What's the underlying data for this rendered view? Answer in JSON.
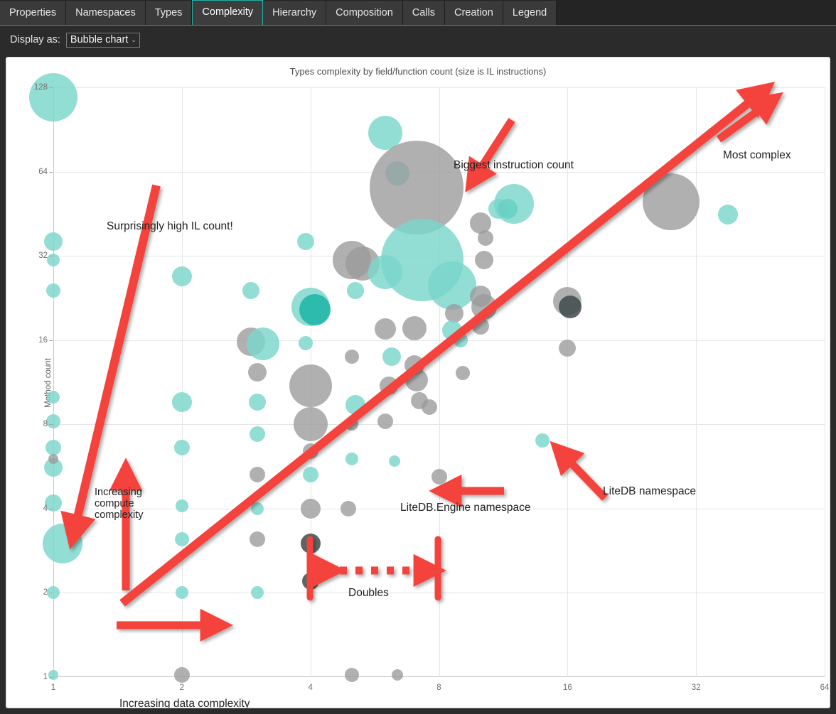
{
  "window": {
    "tabs": [
      {
        "label": "Properties",
        "active": false
      },
      {
        "label": "Namespaces",
        "active": false
      },
      {
        "label": "Types",
        "active": false
      },
      {
        "label": "Complexity",
        "active": true
      },
      {
        "label": "Hierarchy",
        "active": false
      },
      {
        "label": "Composition",
        "active": false
      },
      {
        "label": "Calls",
        "active": false
      },
      {
        "label": "Creation",
        "active": false
      },
      {
        "label": "Legend",
        "active": false
      }
    ]
  },
  "toolbar": {
    "display_as_label": "Display as:",
    "display_as_value": "Bubble chart",
    "chevron": "⌄"
  },
  "colors": {
    "teal": "#7ad6cb",
    "grey": "#9a9a9a",
    "annotation_red": "#f4433c",
    "accent": "#1fb3a5",
    "chrome": "#2b2b2b"
  },
  "chart_data": {
    "type": "scatter",
    "title": "Types complexity by field/function count (size is IL instructions)",
    "xlabel": "",
    "ylabel": "Method count",
    "xscale": "log2",
    "yscale": "log2",
    "xlim": [
      1,
      64
    ],
    "ylim": [
      1,
      128
    ],
    "xticks": [
      1,
      2,
      4,
      8,
      16,
      32,
      64
    ],
    "yticks": [
      1,
      2,
      4,
      8,
      16,
      32,
      64,
      128
    ],
    "grid": true,
    "legend": "none",
    "size_meaning": "IL instructions",
    "series": [
      {
        "name": "LiteDB namespace",
        "color": "#7ad6cb"
      },
      {
        "name": "LiteDB.Engine namespace",
        "color": "#9a9a9a"
      }
    ],
    "points": [
      {
        "x": 1.0,
        "y": 118,
        "r": 34,
        "c": "t"
      },
      {
        "x": 1.0,
        "y": 36,
        "r": 13,
        "c": "t"
      },
      {
        "x": 1.0,
        "y": 31,
        "r": 9,
        "c": "t"
      },
      {
        "x": 1.0,
        "y": 24,
        "r": 10,
        "c": "t"
      },
      {
        "x": 1.0,
        "y": 10,
        "r": 9,
        "c": "t"
      },
      {
        "x": 1.0,
        "y": 8.2,
        "r": 10,
        "c": "t"
      },
      {
        "x": 1.0,
        "y": 6.6,
        "r": 11,
        "c": "t"
      },
      {
        "x": 1.0,
        "y": 5.6,
        "r": 13,
        "c": "t"
      },
      {
        "x": 1.0,
        "y": 4.2,
        "r": 12,
        "c": "t"
      },
      {
        "x": 1.05,
        "y": 3.0,
        "r": 28,
        "c": "t"
      },
      {
        "x": 1.0,
        "y": 2.0,
        "r": 9,
        "c": "t"
      },
      {
        "x": 1.0,
        "y": 1.02,
        "r": 7,
        "c": "t"
      },
      {
        "x": 1.0,
        "y": 6.0,
        "r": 7,
        "c": "g"
      },
      {
        "x": 2.0,
        "y": 27,
        "r": 14,
        "c": "t"
      },
      {
        "x": 2.0,
        "y": 9.6,
        "r": 14,
        "c": "t"
      },
      {
        "x": 2.0,
        "y": 6.6,
        "r": 11,
        "c": "t"
      },
      {
        "x": 2.0,
        "y": 4.1,
        "r": 9,
        "c": "t"
      },
      {
        "x": 2.0,
        "y": 3.1,
        "r": 10,
        "c": "t"
      },
      {
        "x": 2.0,
        "y": 2.0,
        "r": 9,
        "c": "t"
      },
      {
        "x": 2.0,
        "y": 1.02,
        "r": 11,
        "c": "g"
      },
      {
        "x": 2.9,
        "y": 24,
        "r": 12,
        "c": "t"
      },
      {
        "x": 2.9,
        "y": 15.8,
        "r": 20,
        "c": "g"
      },
      {
        "x": 3.1,
        "y": 15.5,
        "r": 23,
        "c": "t"
      },
      {
        "x": 3.0,
        "y": 12.3,
        "r": 13,
        "c": "g"
      },
      {
        "x": 3.0,
        "y": 9.6,
        "r": 12,
        "c": "t"
      },
      {
        "x": 3.0,
        "y": 7.4,
        "r": 11,
        "c": "t"
      },
      {
        "x": 3.0,
        "y": 5.3,
        "r": 11,
        "c": "g"
      },
      {
        "x": 3.0,
        "y": 4.0,
        "r": 9,
        "c": "t"
      },
      {
        "x": 3.0,
        "y": 3.1,
        "r": 11,
        "c": "g"
      },
      {
        "x": 3.0,
        "y": 2.0,
        "r": 9,
        "c": "t"
      },
      {
        "x": 3.9,
        "y": 36,
        "r": 12,
        "c": "t"
      },
      {
        "x": 4.0,
        "y": 21,
        "r": 27,
        "c": "t"
      },
      {
        "x": 4.1,
        "y": 20.5,
        "r": 22,
        "c": "td"
      },
      {
        "x": 3.9,
        "y": 15.6,
        "r": 10,
        "c": "t"
      },
      {
        "x": 4.0,
        "y": 11,
        "r": 30,
        "c": "g"
      },
      {
        "x": 4.0,
        "y": 8.0,
        "r": 24,
        "c": "g"
      },
      {
        "x": 4.0,
        "y": 6.4,
        "r": 11,
        "c": "g"
      },
      {
        "x": 4.0,
        "y": 5.3,
        "r": 11,
        "c": "t"
      },
      {
        "x": 4.0,
        "y": 4.0,
        "r": 14,
        "c": "g"
      },
      {
        "x": 4.0,
        "y": 3.0,
        "r": 14,
        "c": "gd"
      },
      {
        "x": 4.0,
        "y": 2.2,
        "r": 12,
        "c": "gd"
      },
      {
        "x": 5.0,
        "y": 31,
        "r": 27,
        "c": "g"
      },
      {
        "x": 5.3,
        "y": 30,
        "r": 24,
        "c": "g"
      },
      {
        "x": 5.1,
        "y": 24,
        "r": 12,
        "c": "t"
      },
      {
        "x": 5.0,
        "y": 14,
        "r": 10,
        "c": "g"
      },
      {
        "x": 5.1,
        "y": 9.4,
        "r": 14,
        "c": "t"
      },
      {
        "x": 5.0,
        "y": 8.0,
        "r": 9,
        "c": "g"
      },
      {
        "x": 5.0,
        "y": 6.0,
        "r": 9,
        "c": "t"
      },
      {
        "x": 4.9,
        "y": 4.0,
        "r": 11,
        "c": "g"
      },
      {
        "x": 5.0,
        "y": 1.02,
        "r": 10,
        "c": "g"
      },
      {
        "x": 6.0,
        "y": 88,
        "r": 24,
        "c": "t"
      },
      {
        "x": 6.4,
        "y": 63,
        "r": 17,
        "c": "t"
      },
      {
        "x": 6.0,
        "y": 28,
        "r": 24,
        "c": "t"
      },
      {
        "x": 6.0,
        "y": 17.5,
        "r": 15,
        "c": "g"
      },
      {
        "x": 6.2,
        "y": 14,
        "r": 13,
        "c": "t"
      },
      {
        "x": 6.1,
        "y": 11,
        "r": 13,
        "c": "g"
      },
      {
        "x": 6.0,
        "y": 8.2,
        "r": 11,
        "c": "g"
      },
      {
        "x": 6.3,
        "y": 5.9,
        "r": 8,
        "c": "t"
      },
      {
        "x": 6.4,
        "y": 1.02,
        "r": 8,
        "c": "g"
      },
      {
        "x": 7.1,
        "y": 56,
        "r": 66,
        "c": "g"
      },
      {
        "x": 7.3,
        "y": 31,
        "r": 58,
        "c": "t"
      },
      {
        "x": 7.0,
        "y": 17.6,
        "r": 17,
        "c": "g"
      },
      {
        "x": 7.0,
        "y": 13,
        "r": 14,
        "c": "g"
      },
      {
        "x": 7.1,
        "y": 11.5,
        "r": 16,
        "c": "g"
      },
      {
        "x": 7.2,
        "y": 9.7,
        "r": 12,
        "c": "g"
      },
      {
        "x": 7.6,
        "y": 9.2,
        "r": 11,
        "c": "g"
      },
      {
        "x": 8.0,
        "y": 5.2,
        "r": 11,
        "c": "g"
      },
      {
        "x": 8.6,
        "y": 25,
        "r": 34,
        "c": "t"
      },
      {
        "x": 8.7,
        "y": 20,
        "r": 13,
        "c": "g"
      },
      {
        "x": 8.6,
        "y": 17.3,
        "r": 14,
        "c": "t"
      },
      {
        "x": 9.0,
        "y": 16,
        "r": 10,
        "c": "t"
      },
      {
        "x": 9.1,
        "y": 12.2,
        "r": 10,
        "c": "g"
      },
      {
        "x": 10.0,
        "y": 42,
        "r": 15,
        "c": "g"
      },
      {
        "x": 10.3,
        "y": 37,
        "r": 11,
        "c": "g"
      },
      {
        "x": 10.2,
        "y": 31,
        "r": 13,
        "c": "g"
      },
      {
        "x": 10.0,
        "y": 23,
        "r": 15,
        "c": "g"
      },
      {
        "x": 10.2,
        "y": 21,
        "r": 18,
        "c": "g"
      },
      {
        "x": 10.0,
        "y": 18,
        "r": 12,
        "c": "g"
      },
      {
        "x": 11.0,
        "y": 47,
        "r": 14,
        "c": "t"
      },
      {
        "x": 11.6,
        "y": 47,
        "r": 14,
        "c": "td"
      },
      {
        "x": 12.0,
        "y": 49,
        "r": 28,
        "c": "t"
      },
      {
        "x": 14.0,
        "y": 7.0,
        "r": 10,
        "c": "t"
      },
      {
        "x": 16.0,
        "y": 22,
        "r": 20,
        "c": "g"
      },
      {
        "x": 16.2,
        "y": 21,
        "r": 16,
        "c": "gd"
      },
      {
        "x": 16.0,
        "y": 15,
        "r": 12,
        "c": "g"
      },
      {
        "x": 28.0,
        "y": 50,
        "r": 40,
        "c": "g"
      },
      {
        "x": 38.0,
        "y": 45,
        "r": 14,
        "c": "t"
      }
    ]
  },
  "annotations": [
    {
      "id": "surprising-il",
      "text": "Surprisingly high IL count!"
    },
    {
      "id": "biggest-instruction",
      "text": "Biggest instruction count"
    },
    {
      "id": "most-complex",
      "text": "Most complex"
    },
    {
      "id": "increasing-compute",
      "text": "Increasing\ncompute\ncomplexity"
    },
    {
      "id": "increasing-data",
      "text": "Increasing data complexity"
    },
    {
      "id": "doubles",
      "text": "Doubles"
    },
    {
      "id": "litedb-engine-ns",
      "text": "LiteDB.Engine namespace"
    },
    {
      "id": "litedb-ns",
      "text": "LiteDB namespace"
    }
  ]
}
